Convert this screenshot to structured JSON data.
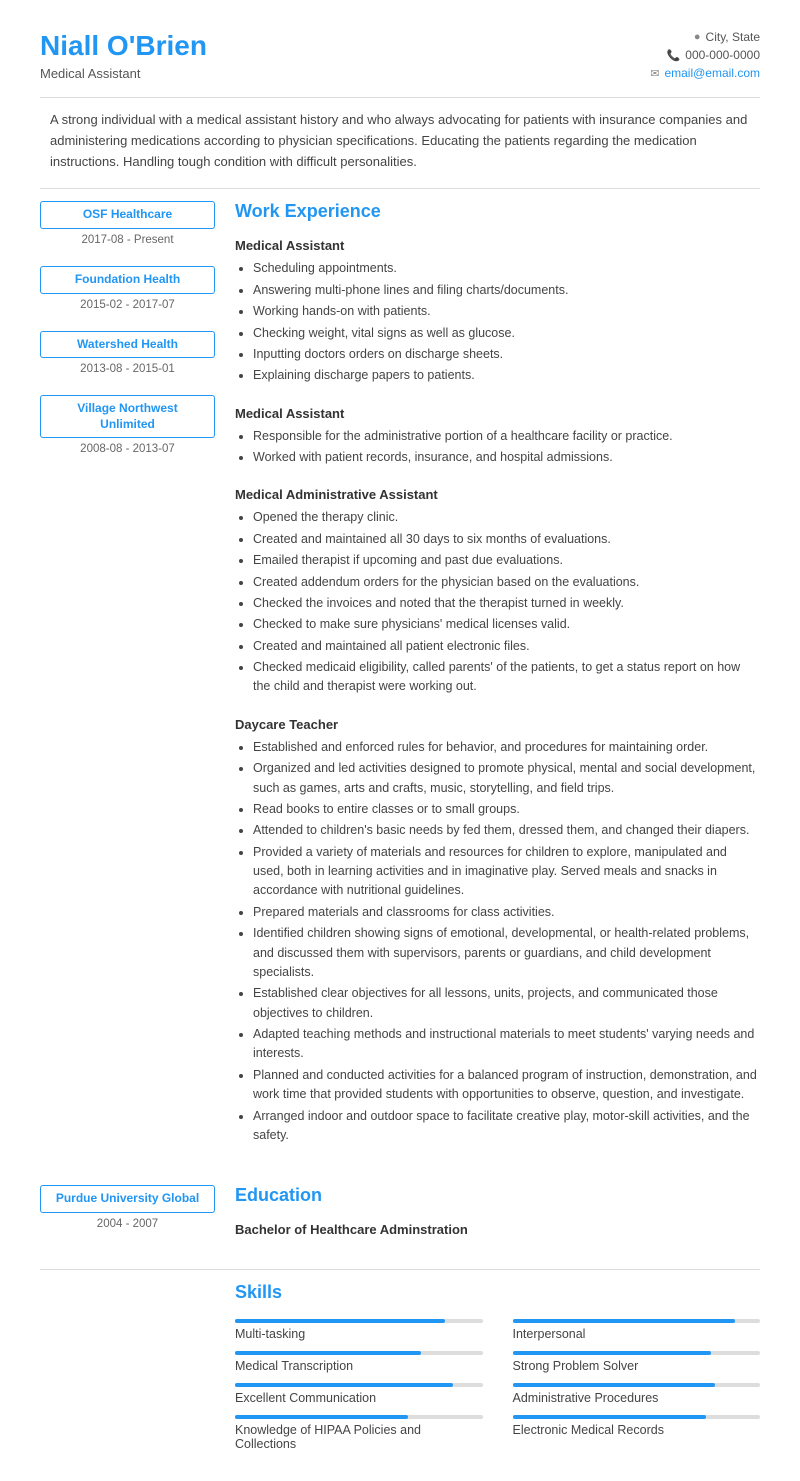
{
  "header": {
    "name": "Niall O'Brien",
    "job_title": "Medical Assistant",
    "city_state": "City, State",
    "phone": "000-000-0000",
    "email": "email@email.com"
  },
  "summary": "A strong individual with a medical assistant history and who always advocating for patients with insurance companies and administering medications according to physician specifications. Educating the patients regarding the medication instructions. Handling tough condition with difficult personalities.",
  "work_experience": {
    "section_title": "Work Experience",
    "jobs": [
      {
        "employer": "OSF Healthcare",
        "dates": "2017-08 - Present",
        "title": "Medical Assistant",
        "bullets": [
          "Scheduling appointments.",
          "Answering multi-phone lines and filing charts/documents.",
          "Working hands-on with patients.",
          "Checking weight, vital signs as well as glucose.",
          "Inputting doctors orders on discharge sheets.",
          "Explaining discharge papers to patients."
        ]
      },
      {
        "employer": "Foundation Health",
        "dates": "2015-02 - 2017-07",
        "title": "Medical Assistant",
        "bullets": [
          "Responsible for the administrative portion of a healthcare facility or practice.",
          "Worked with patient records, insurance, and hospital admissions."
        ]
      },
      {
        "employer": "Watershed Health",
        "dates": "2013-08 - 2015-01",
        "title": "Medical Administrative Assistant",
        "bullets": [
          "Opened the therapy clinic.",
          "Created and maintained all 30 days to six months of evaluations.",
          "Emailed therapist if upcoming and past due evaluations.",
          "Created addendum orders for the physician based on the evaluations.",
          "Checked the invoices and noted that the therapist turned in weekly.",
          "Checked to make sure physicians' medical licenses valid.",
          "Created and maintained all patient electronic files.",
          "Checked medicaid eligibility, called parents' of the patients, to get a status report on how the child and therapist were working out."
        ]
      },
      {
        "employer": "Village Northwest Unlimited",
        "dates": "2008-08 - 2013-07",
        "title": "Daycare Teacher",
        "bullets": [
          "Established and enforced rules for behavior, and procedures for maintaining order.",
          "Organized and led activities designed to promote physical, mental and social development, such as games, arts and crafts, music, storytelling, and field trips.",
          "Read books to entire classes or to small groups.",
          "Attended to children's basic needs by fed them, dressed them, and changed their diapers.",
          "Provided a variety of materials and resources for children to explore, manipulated and used, both in learning activities and in imaginative play. Served meals and snacks in accordance with nutritional guidelines.",
          "Prepared materials and classrooms for class activities.",
          "Identified children showing signs of emotional, developmental, or health-related problems, and discussed them with supervisors, parents or guardians, and child development specialists.",
          "Established clear objectives for all lessons, units, projects, and communicated those objectives to children.",
          "Adapted teaching methods and instructional materials to meet students' varying needs and interests.",
          "Planned and conducted activities for a balanced program of instruction, demonstration, and work time that provided students with opportunities to observe, question, and investigate.",
          "Arranged indoor and outdoor space to facilitate creative play, motor-skill activities, and the safety."
        ]
      }
    ]
  },
  "education": {
    "section_title": "Education",
    "entries": [
      {
        "institution": "Purdue University Global",
        "dates": "2004 - 2007",
        "degree": "Bachelor of Healthcare Adminstration"
      }
    ]
  },
  "skills": {
    "section_title": "Skills",
    "items": [
      {
        "label": "Multi-tasking",
        "pct": 85
      },
      {
        "label": "Interpersonal",
        "pct": 90
      },
      {
        "label": "Medical Transcription",
        "pct": 75
      },
      {
        "label": "Strong Problem Solver",
        "pct": 80
      },
      {
        "label": "Excellent Communication",
        "pct": 88
      },
      {
        "label": "Administrative Procedures",
        "pct": 82
      },
      {
        "label": "Knowledge of HIPAA Policies and Collections",
        "pct": 70
      },
      {
        "label": "Electronic Medical Records",
        "pct": 78
      }
    ]
  }
}
